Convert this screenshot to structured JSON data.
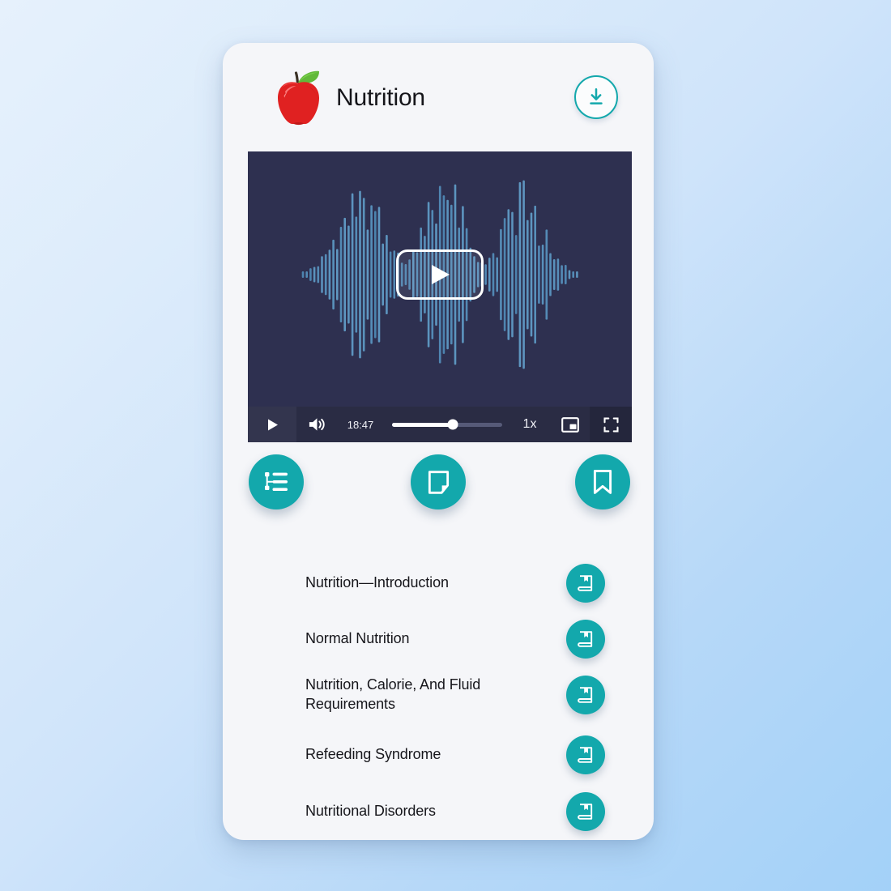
{
  "app": {
    "title": "Nutrition",
    "logo_icon": "red-apple-icon"
  },
  "header": {
    "download_icon": "download-icon",
    "download_label": "Download"
  },
  "player": {
    "overlay_play_icon": "play-triangle-icon",
    "waveform_icon": "audio-waveform",
    "controls": {
      "play_icon": "play-icon",
      "volume_icon": "volume-high-icon",
      "time": "18:47",
      "progress_percent": 55,
      "speed": "1x",
      "pip_icon": "picture-in-picture-icon",
      "fullscreen_icon": "fullscreen-icon"
    },
    "colors": {
      "stage_bg": "#2e3050",
      "controls_bg": "#2a2c44",
      "waveform": "#4a7fb0"
    }
  },
  "actions": [
    {
      "name": "outline",
      "icon": "list-tree-icon",
      "label": "Outline"
    },
    {
      "name": "notes",
      "icon": "sticky-note-icon",
      "label": "Notes"
    },
    {
      "name": "bookmarks",
      "icon": "bookmark-icon",
      "label": "Bookmarks"
    }
  ],
  "chapters": [
    {
      "title": "Nutrition—Introduction",
      "icon": "book-bookmark-icon"
    },
    {
      "title": "Normal Nutrition",
      "icon": "book-bookmark-icon"
    },
    {
      "title": "Nutrition, Calorie, And Fluid Requirements",
      "icon": "book-bookmark-icon"
    },
    {
      "title": "Refeeding Syndrome",
      "icon": "book-bookmark-icon"
    },
    {
      "title": "Nutritional Disorders",
      "icon": "book-bookmark-icon"
    }
  ],
  "theme": {
    "accent": "#13a8ac",
    "card_bg": "#f5f6f9",
    "page_bg_start": "#e6f1fc",
    "page_bg_end": "#a3d1f8",
    "text": "#16161b"
  }
}
